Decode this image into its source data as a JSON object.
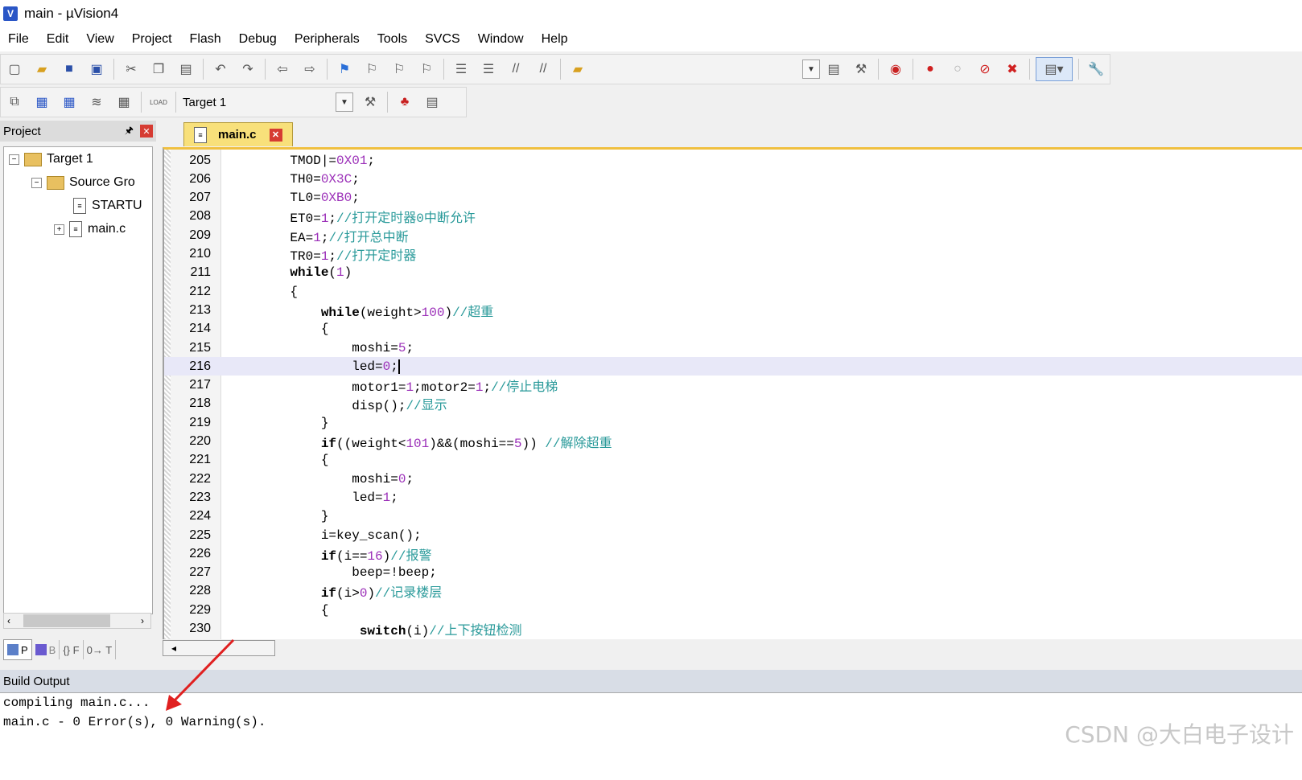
{
  "window": {
    "title": "main  - µVision4"
  },
  "menu": [
    "File",
    "Edit",
    "View",
    "Project",
    "Flash",
    "Debug",
    "Peripherals",
    "Tools",
    "SVCS",
    "Window",
    "Help"
  ],
  "toolbar2": {
    "load_label": "LOAD",
    "target": "Target 1"
  },
  "project": {
    "title": "Project",
    "tree": [
      {
        "label": "Target 1"
      },
      {
        "label": "Source Gro"
      },
      {
        "label": "STARTU"
      },
      {
        "label": "main.c"
      }
    ],
    "tabs": [
      "P",
      "B",
      "{} F",
      "0→ T"
    ]
  },
  "editor": {
    "tab_name": "main.c",
    "lines": [
      {
        "n": "205",
        "c": "    TMOD|=0X01;"
      },
      {
        "n": "206",
        "c": "    TH0=0X3C;"
      },
      {
        "n": "207",
        "c": "    TL0=0XB0;"
      },
      {
        "n": "208",
        "c": "    ET0=1;//打开定时器0中断允许"
      },
      {
        "n": "209",
        "c": "    EA=1;//打开总中断"
      },
      {
        "n": "210",
        "c": "    TR0=1;//打开定时器"
      },
      {
        "n": "211",
        "c": "    while(1)"
      },
      {
        "n": "212",
        "c": "    {"
      },
      {
        "n": "213",
        "c": "        while(weight>100)//超重"
      },
      {
        "n": "214",
        "c": "        {"
      },
      {
        "n": "215",
        "c": "            moshi=5;"
      },
      {
        "n": "216",
        "c": "            led=0;"
      },
      {
        "n": "217",
        "c": "            motor1=1;motor2=1;//停止电梯"
      },
      {
        "n": "218",
        "c": "            disp();//显示"
      },
      {
        "n": "219",
        "c": "        }"
      },
      {
        "n": "220",
        "c": "        if((weight<101)&&(moshi==5)) //解除超重"
      },
      {
        "n": "221",
        "c": "        {"
      },
      {
        "n": "222",
        "c": "            moshi=0;"
      },
      {
        "n": "223",
        "c": "            led=1;"
      },
      {
        "n": "224",
        "c": "        }"
      },
      {
        "n": "225",
        "c": "        i=key_scan();"
      },
      {
        "n": "226",
        "c": "        if(i==16)//报警"
      },
      {
        "n": "227",
        "c": "            beep=!beep;"
      },
      {
        "n": "228",
        "c": "        if(i>0)//记录楼层"
      },
      {
        "n": "229",
        "c": "        {"
      },
      {
        "n": "230",
        "c": "             switch(i)//上下按钮检测"
      }
    ],
    "current_line": "216"
  },
  "build": {
    "title": "Build Output",
    "lines": [
      "compiling main.c...",
      "main.c - 0 Error(s), 0 Warning(s)."
    ]
  },
  "watermark": "CSDN @大白电子设计",
  "colors": {
    "comment": "#2a9a9a",
    "number": "#9b2fb8",
    "tab": "#f8e07a",
    "current_line": "#e8e8f8"
  }
}
